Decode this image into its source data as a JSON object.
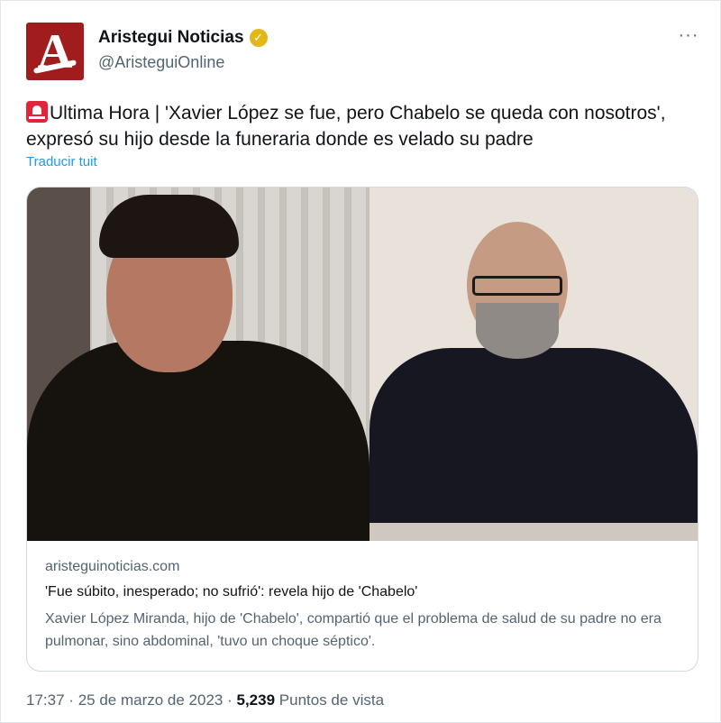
{
  "author": {
    "name": "Aristegui Noticias",
    "handle": "@AristeguiOnline",
    "avatar_letter": "A",
    "avatar_color": "#a11d1d",
    "verified_icon": "verified-gold-icon",
    "verified_color": "#e2b719"
  },
  "tweet": {
    "emoji_icon": "siren-icon",
    "text": "Ultima Hora | 'Xavier López se fue, pero Chabelo se queda con nosotros', expresó su hijo desde la funeraria donde es velado su padre",
    "translate": "Traducir tuit"
  },
  "link_card": {
    "domain": "aristeguinoticias.com",
    "title": "'Fue súbito, inesperado; no sufrió': revela hijo de 'Chabelo'",
    "description": "Xavier López Miranda, hijo de 'Chabelo', compartió que el problema de salud de su padre no era pulmonar, sino abdominal, 'tuvo un choque séptico'."
  },
  "meta": {
    "time": "17:37",
    "date": "25 de marzo de 2023",
    "views": "5,239",
    "views_label": "Puntos de vista",
    "separator": "·"
  },
  "colors": {
    "link": "#1d9bf0",
    "secondary_text": "#536471",
    "primary_text": "#0f1419",
    "border": "#cfd9de"
  }
}
